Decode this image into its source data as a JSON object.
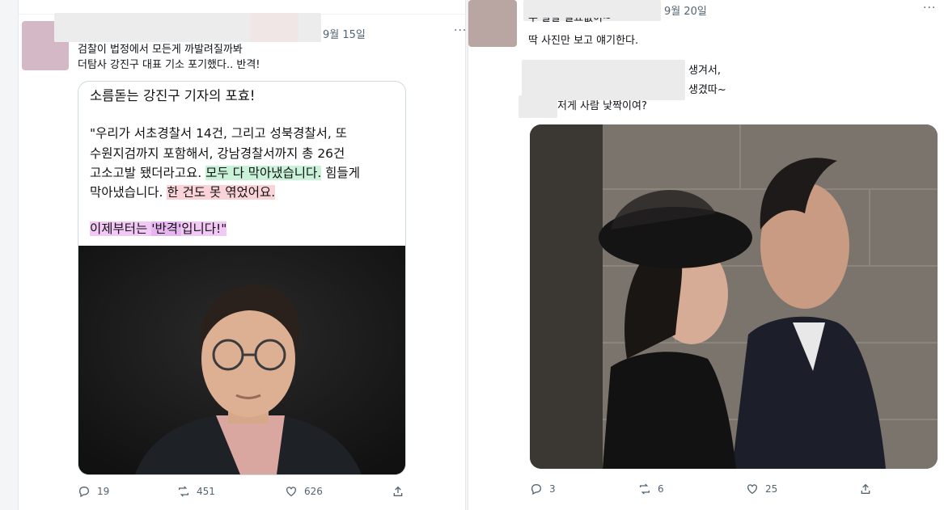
{
  "left_tweet": {
    "date": "9월 15일",
    "more": "···",
    "text_line1": "검찰이 법정에서 모든게 까발려질까봐",
    "text_line2": "더탐사 강진구 대표 기소 포기했다.. 반격!",
    "card": {
      "title": "소름돋는 강진구 기자의 포효!",
      "quote_l1": "\"우리가 서초경찰서 14건, 그리고 성북경찰서, 또",
      "quote_l2": "수원지검까지 포함해서, 강남경찰서까지 총 26건",
      "quote_l3a": "고소고발 됐더라고요. ",
      "quote_l3b": "모두 다 막아냈습니다.",
      "quote_l3c": " 힘들게",
      "quote_l4a": "막아냈습니다. ",
      "quote_l4b": "한 건도 못 엮었어요.",
      "quote_l5a": "이제부터는 ",
      "quote_l5b": "'반격'",
      "quote_l5c": "입니다!\""
    },
    "actions": {
      "reply": "19",
      "retweet": "451",
      "like": "626"
    }
  },
  "right_tweet": {
    "date": "9월 20일",
    "more": "···",
    "line_top": "두 말할 필요없이~",
    "line2": "딱 사진만 보고 얘기한다.",
    "line3": "생겨서,",
    "line4": "생겼따~",
    "line5": "저게 사람 낯짝이여?",
    "actions": {
      "reply": "3",
      "retweet": "6",
      "like": "25"
    }
  },
  "icons": [
    "reply-icon",
    "retweet-icon",
    "like-icon",
    "share-icon"
  ],
  "colors": {
    "icon": "#536471",
    "highlight_green": "#c9f2d9",
    "highlight_pink": "#f9d3d8",
    "highlight_purple": "#f2c8f5"
  }
}
